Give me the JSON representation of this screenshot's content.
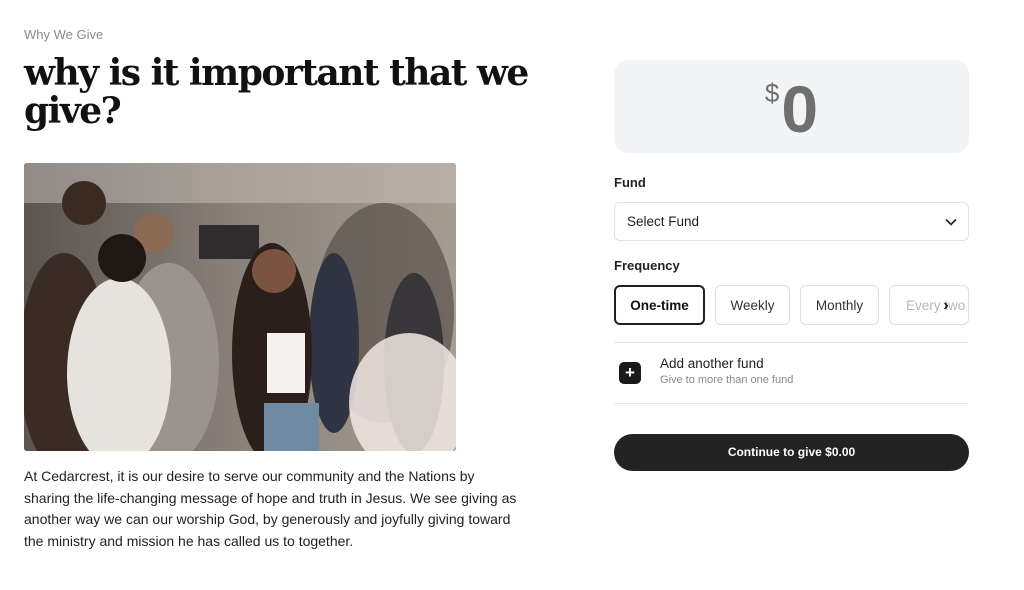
{
  "intro": {
    "eyebrow": "Why We Give",
    "headline": "why is it important that we give?",
    "body": "At Cedarcrest, it is our desire to serve our community and the Nations by sharing the life-changing message of hope and truth in Jesus. We see giving as another way we can our worship God, by generously and joyfully giving toward the ministry and mission he has called us to together."
  },
  "giving": {
    "amount": {
      "currency": "$",
      "value": "0"
    },
    "fund": {
      "label": "Fund",
      "selected": "Select Fund",
      "icon": "chevron-down-icon"
    },
    "frequency": {
      "label": "Frequency",
      "options": [
        "One-time",
        "Weekly",
        "Monthly",
        "Every two"
      ],
      "selected": "One-time",
      "scroll_icon": "chevron-right-icon"
    },
    "add_fund": {
      "title": "Add another fund",
      "subtitle": "Give to more than one fund",
      "icon": "plus-icon"
    },
    "continue_label": "Continue to give $0.00"
  },
  "colors": {
    "primary": "#232323",
    "amount_bg": "#f3f4f5",
    "border": "#dedede"
  }
}
